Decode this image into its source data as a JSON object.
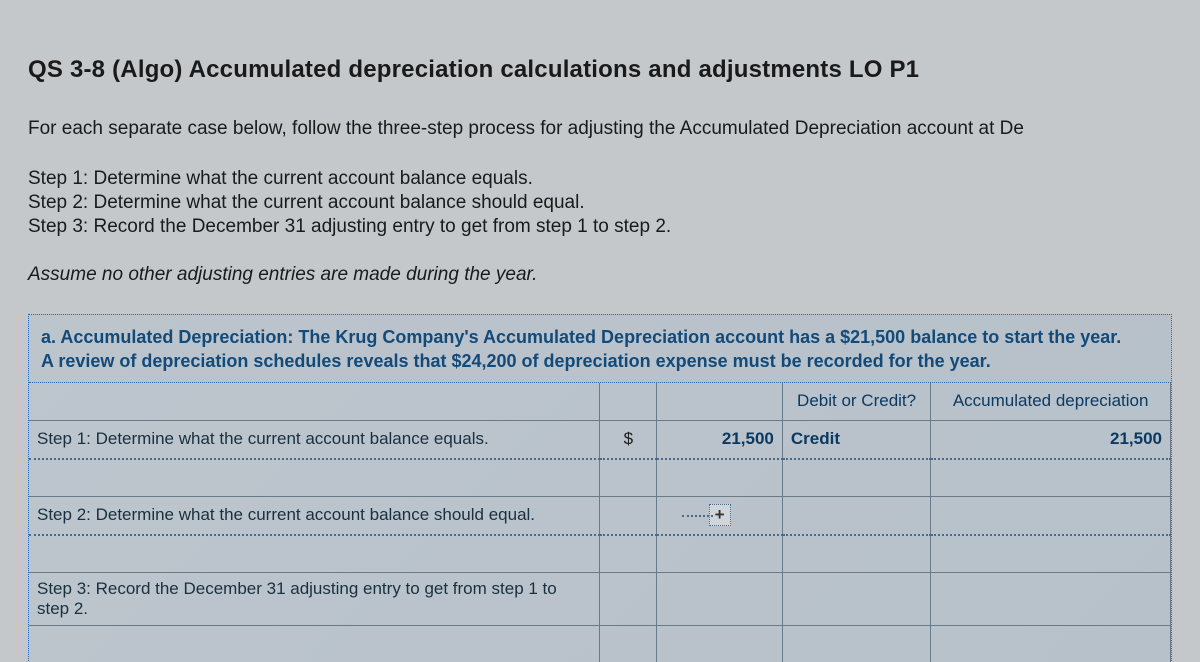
{
  "title": "QS 3-8 (Algo) Accumulated depreciation calculations and adjustments LO P1",
  "intro": "For each separate case below, follow the three-step process for adjusting the Accumulated Depreciation account at De",
  "steps": {
    "s1": "Step 1: Determine what the current account balance equals.",
    "s2": "Step 2: Determine what the current account balance should equal.",
    "s3": "Step 3: Record the December 31 adjusting entry to get from step 1 to step 2."
  },
  "assume": "Assume no other adjusting entries are made during the year.",
  "case_a": {
    "header_line1": "a. Accumulated Depreciation: The Krug Company's Accumulated Depreciation account has a $21,500 balance to start the year.",
    "header_line2": "A review of depreciation schedules reveals that $24,200 of depreciation expense must be recorded for the year.",
    "col_debit_credit": "Debit or Credit?",
    "col_accdep": "Accumulated depreciation",
    "rows": {
      "r1": {
        "label": "Step 1: Determine what the current account balance equals.",
        "sym": "$",
        "amount": "21,500",
        "doc": "Credit",
        "acc": "21,500"
      },
      "r2": {
        "label": "Step 2: Determine what the current account balance should equal."
      },
      "r3": {
        "label": "Step 3: Record the December 31 adjusting entry to get from step 1 to step 2."
      }
    },
    "plus": "+"
  }
}
